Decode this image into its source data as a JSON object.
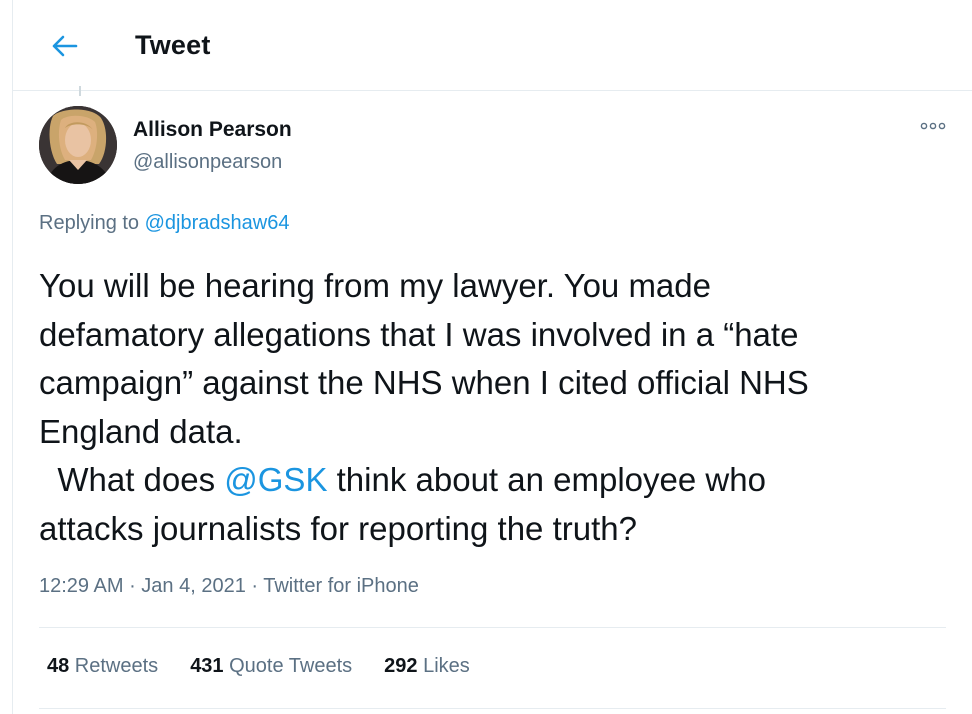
{
  "header": {
    "back_icon": "back-arrow-icon",
    "title": "Tweet"
  },
  "author": {
    "name": "Allison Pearson",
    "handle": "@allisonpearson",
    "more_icon": "more-options-icon"
  },
  "reply": {
    "prefix": "Replying to ",
    "handle": "@djbradshaw64"
  },
  "tweet": {
    "line1": "You will be hearing from my lawyer. You made",
    "line2": "defamatory allegations that I was involved in a “hate",
    "line3": "campaign” against the NHS when I cited official NHS",
    "line4": "England data.",
    "line5_before": "  What does ",
    "line5_mention": "@GSK",
    "line5_after": " think about an employee who",
    "line6": "attacks journalists for reporting the truth?"
  },
  "meta": {
    "time": "12:29 AM",
    "sep1": " · ",
    "date": "Jan 4, 2021",
    "sep2": " · ",
    "source": "Twitter for iPhone"
  },
  "stats": {
    "retweets_count": "48",
    "retweets_label": " Retweets",
    "quotes_count": "431",
    "quotes_label": " Quote Tweets",
    "likes_count": "292",
    "likes_label": " Likes"
  },
  "colors": {
    "accent": "#1b95e0",
    "secondary_text": "#5b7083",
    "primary_text": "#0f1419",
    "border": "#e6ecf0"
  }
}
